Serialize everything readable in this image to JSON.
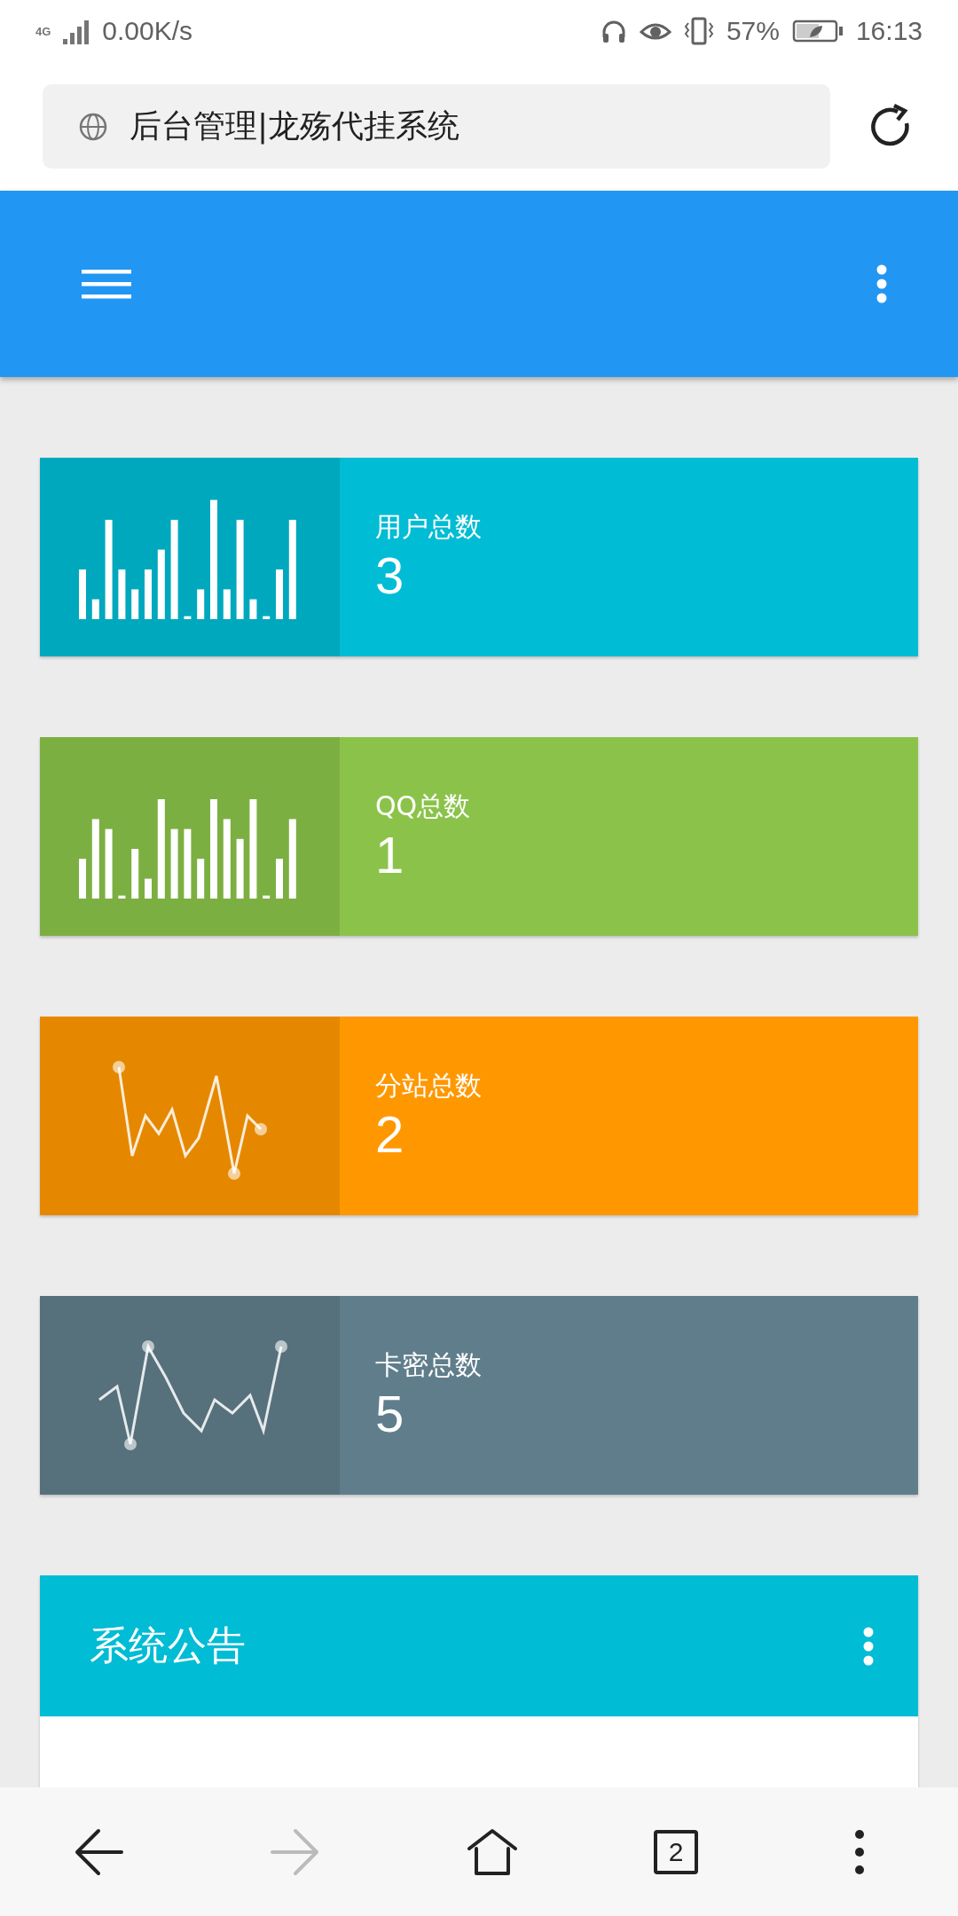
{
  "status_bar": {
    "network": "4G",
    "speed": "0.00K/s",
    "battery": "57%",
    "time": "16:13"
  },
  "address_bar": {
    "title": "后台管理|龙殇代挂系统"
  },
  "stat_cards": [
    {
      "label": "用户总数",
      "value": "3",
      "kind": "bar",
      "color": "#00bcd4"
    },
    {
      "label": "QQ总数",
      "value": "1",
      "kind": "bar",
      "color": "#8bc34a"
    },
    {
      "label": "分站总数",
      "value": "2",
      "kind": "line",
      "color": "#ff9800"
    },
    {
      "label": "卡密总数",
      "value": "5",
      "kind": "line",
      "color": "#607d8b"
    }
  ],
  "notice_panel": {
    "title": "系统公告"
  },
  "bottom_nav": [
    {
      "kind": "back",
      "disabled": false
    },
    {
      "kind": "forward",
      "disabled": true
    },
    {
      "kind": "home",
      "disabled": false
    },
    {
      "kind": "tabs",
      "count": "2",
      "disabled": false
    },
    {
      "kind": "menu",
      "disabled": false
    }
  ]
}
